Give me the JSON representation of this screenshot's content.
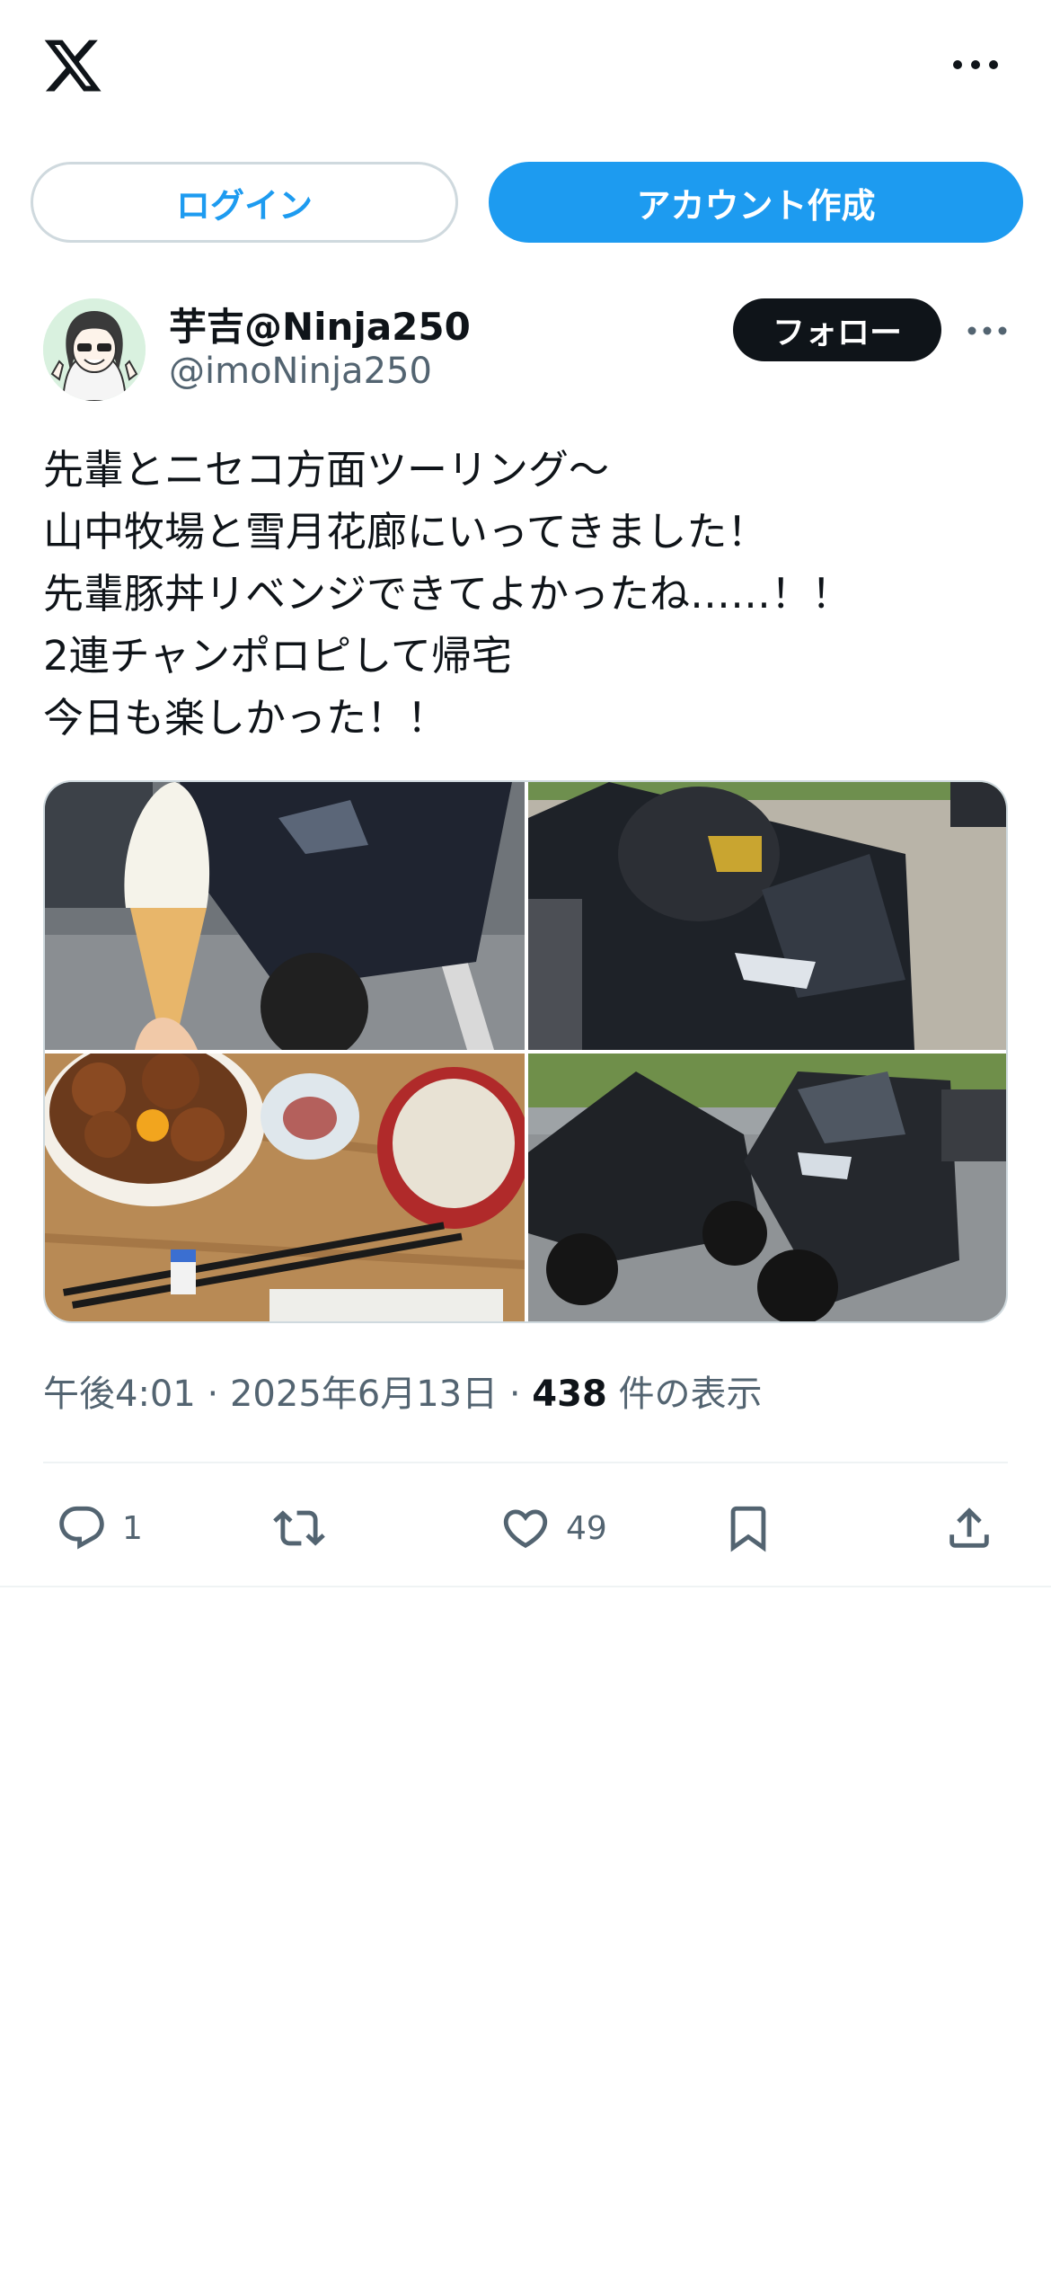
{
  "topbar": {
    "logo_icon": "x-logo-icon",
    "more_icon": "more-horizontal-icon"
  },
  "auth": {
    "login_label": "ログイン",
    "signup_label": "アカウント作成"
  },
  "post": {
    "author": {
      "display_name": "芋吉@Ninja250",
      "handle": "@imoNinja250"
    },
    "follow_label": "フォロー",
    "text_lines": [
      "先輩とニセコ方面ツーリング〜",
      "山中牧場と雪月花廊にいってきました！",
      "先輩豚丼リベンジできてよかったね……！！",
      "2連チャンポロピして帰宅",
      "今日も楽しかった！！"
    ],
    "meta": {
      "time": "午後4:01",
      "sep1": " · ",
      "date": "2025年6月13日",
      "sep2": " · ",
      "views_count": "438",
      "views_label": " 件の表示"
    },
    "actions": {
      "reply_count": "1",
      "retweet_count": "",
      "like_count": "49"
    }
  },
  "colors": {
    "accent": "#1d9bf0",
    "text": "#0f1419",
    "secondary": "#536471",
    "border": "#cfd9de"
  }
}
